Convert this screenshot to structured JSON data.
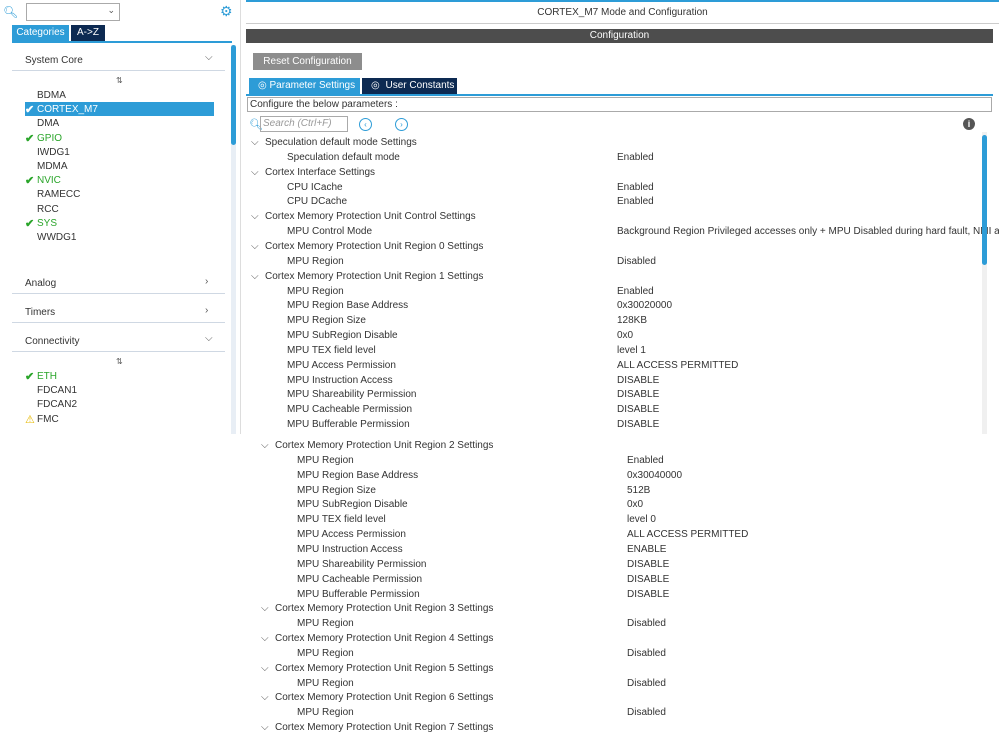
{
  "left": {
    "tabs": [
      "Categories",
      "A->Z"
    ],
    "groups": {
      "system_core": "System Core",
      "analog": "Analog",
      "timers": "Timers",
      "connectivity": "Connectivity"
    },
    "system_core_items": [
      {
        "label": "BDMA",
        "state": "none"
      },
      {
        "label": "CORTEX_M7",
        "state": "selected"
      },
      {
        "label": "DMA",
        "state": "none"
      },
      {
        "label": "GPIO",
        "state": "ok"
      },
      {
        "label": "IWDG1",
        "state": "none"
      },
      {
        "label": "MDMA",
        "state": "none"
      },
      {
        "label": "NVIC",
        "state": "ok"
      },
      {
        "label": "RAMECC",
        "state": "none"
      },
      {
        "label": "RCC",
        "state": "none"
      },
      {
        "label": "SYS",
        "state": "ok"
      },
      {
        "label": "WWDG1",
        "state": "none"
      }
    ],
    "connectivity_items": [
      {
        "label": "ETH",
        "state": "ok"
      },
      {
        "label": "FDCAN1",
        "state": "none"
      },
      {
        "label": "FDCAN2",
        "state": "none"
      },
      {
        "label": "FMC",
        "state": "warn"
      }
    ]
  },
  "right": {
    "title": "CORTEX_M7 Mode and Configuration",
    "configuration": "Configuration",
    "reset_label": "Reset Configuration",
    "tab_params": "Parameter Settings",
    "tab_constants": "User Constants",
    "configure_text": "Configure the below parameters :",
    "search_placeholder": "Search (Ctrl+F)"
  },
  "rows_top": [
    {
      "type": "section",
      "text": "Speculation default mode Settings"
    },
    {
      "type": "param",
      "name": "Speculation default mode",
      "value": "Enabled"
    },
    {
      "type": "section",
      "text": "Cortex Interface Settings"
    },
    {
      "type": "param",
      "name": "CPU ICache",
      "value": "Enabled"
    },
    {
      "type": "param",
      "name": "CPU DCache",
      "value": "Enabled"
    },
    {
      "type": "section",
      "text": "Cortex Memory Protection Unit Control Settings"
    },
    {
      "type": "param",
      "name": "MPU Control Mode",
      "value": "Background Region Privileged accesses only + MPU Disabled during hard fault, NMI a"
    },
    {
      "type": "section",
      "text": "Cortex Memory Protection Unit Region 0 Settings"
    },
    {
      "type": "param",
      "name": "MPU Region",
      "value": "Disabled"
    },
    {
      "type": "section",
      "text": "Cortex Memory Protection Unit Region 1 Settings"
    },
    {
      "type": "param",
      "name": "MPU Region",
      "value": "Enabled"
    },
    {
      "type": "param",
      "name": "MPU Region Base Address",
      "value": "0x30020000"
    },
    {
      "type": "param",
      "name": "MPU Region Size",
      "value": "128KB"
    },
    {
      "type": "param",
      "name": "MPU SubRegion Disable",
      "value": "0x0"
    },
    {
      "type": "param",
      "name": "MPU TEX field level",
      "value": "level 1"
    },
    {
      "type": "param",
      "name": "MPU Access Permission",
      "value": "ALL ACCESS PERMITTED"
    },
    {
      "type": "param",
      "name": "MPU Instruction Access",
      "value": "DISABLE"
    },
    {
      "type": "param",
      "name": "MPU Shareability Permission",
      "value": "DISABLE"
    },
    {
      "type": "param",
      "name": "MPU Cacheable Permission",
      "value": "DISABLE"
    },
    {
      "type": "param",
      "name": "MPU Bufferable  Permission",
      "value": "DISABLE"
    }
  ],
  "rows_bottom": [
    {
      "type": "section",
      "text": "Cortex Memory Protection Unit Region 2 Settings"
    },
    {
      "type": "param",
      "name": "MPU Region",
      "value": "Enabled"
    },
    {
      "type": "param",
      "name": "MPU Region Base Address",
      "value": "0x30040000"
    },
    {
      "type": "param",
      "name": "MPU Region Size",
      "value": "512B"
    },
    {
      "type": "param",
      "name": "MPU SubRegion Disable",
      "value": "0x0"
    },
    {
      "type": "param",
      "name": "MPU TEX field level",
      "value": "level 0"
    },
    {
      "type": "param",
      "name": "MPU Access Permission",
      "value": "ALL ACCESS PERMITTED"
    },
    {
      "type": "param",
      "name": "MPU Instruction Access",
      "value": "ENABLE"
    },
    {
      "type": "param",
      "name": "MPU Shareability Permission",
      "value": "DISABLE"
    },
    {
      "type": "param",
      "name": "MPU Cacheable Permission",
      "value": "DISABLE"
    },
    {
      "type": "param",
      "name": "MPU Bufferable  Permission",
      "value": "DISABLE"
    },
    {
      "type": "section",
      "text": "Cortex Memory Protection Unit Region 3 Settings"
    },
    {
      "type": "param",
      "name": "MPU Region",
      "value": "Disabled"
    },
    {
      "type": "section",
      "text": "Cortex Memory Protection Unit Region 4 Settings"
    },
    {
      "type": "param",
      "name": "MPU Region",
      "value": "Disabled"
    },
    {
      "type": "section",
      "text": "Cortex Memory Protection Unit Region 5 Settings"
    },
    {
      "type": "param",
      "name": "MPU Region",
      "value": "Disabled"
    },
    {
      "type": "section",
      "text": "Cortex Memory Protection Unit Region 6 Settings"
    },
    {
      "type": "param",
      "name": "MPU Region",
      "value": "Disabled"
    },
    {
      "type": "section",
      "text": "Cortex Memory Protection Unit Region 7 Settings"
    }
  ],
  "colors": {
    "accent": "#2d9cd7",
    "dark_tab": "#0d2a52",
    "ok": "#2aa52a",
    "warn": "#e6b800"
  },
  "icons": [
    "search-icon",
    "dropdown-icon",
    "gear-icon",
    "chevron-down-icon",
    "chevron-right-icon",
    "sort-icon",
    "check-icon",
    "warning-icon",
    "info-icon",
    "prev-icon",
    "next-icon"
  ]
}
